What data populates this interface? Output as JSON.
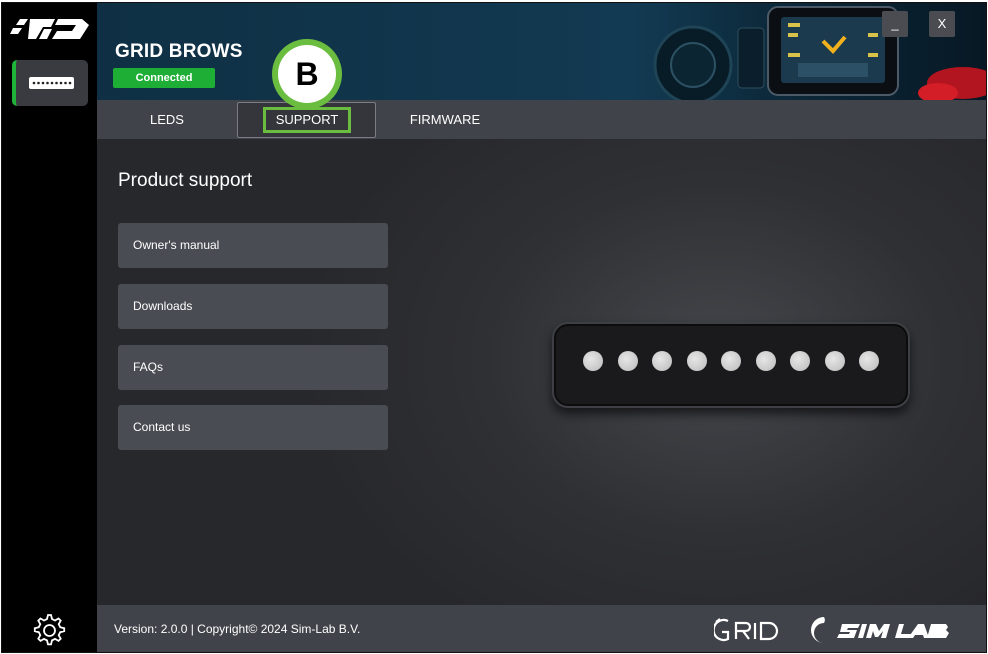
{
  "header": {
    "device_name": "GRID BROWS",
    "status": "Connected",
    "minimize": "_",
    "close": "X"
  },
  "tabs": [
    {
      "label": "LEDS"
    },
    {
      "label": "SUPPORT"
    },
    {
      "label": "FIRMWARE"
    }
  ],
  "marker": "B",
  "main": {
    "title": "Product support",
    "buttons": [
      {
        "label": "Owner's manual"
      },
      {
        "label": "Downloads"
      },
      {
        "label": "FAQs"
      },
      {
        "label": "Contact us"
      }
    ],
    "led_count": 9
  },
  "footer": {
    "version": "Version: 2.0.0 | Copyright© 2024 Sim-Lab B.V."
  },
  "icons": {
    "brand_logo": "grid-rd-logo-icon",
    "device": "device-icon",
    "settings": "gear-icon",
    "footer_logo_1": "grid-logo-icon",
    "footer_logo_2": "sim-lab-logo-icon"
  },
  "colors": {
    "accent_green": "#1fae35",
    "highlight_green": "#6bbd3f",
    "header_blue": "#11364d"
  }
}
